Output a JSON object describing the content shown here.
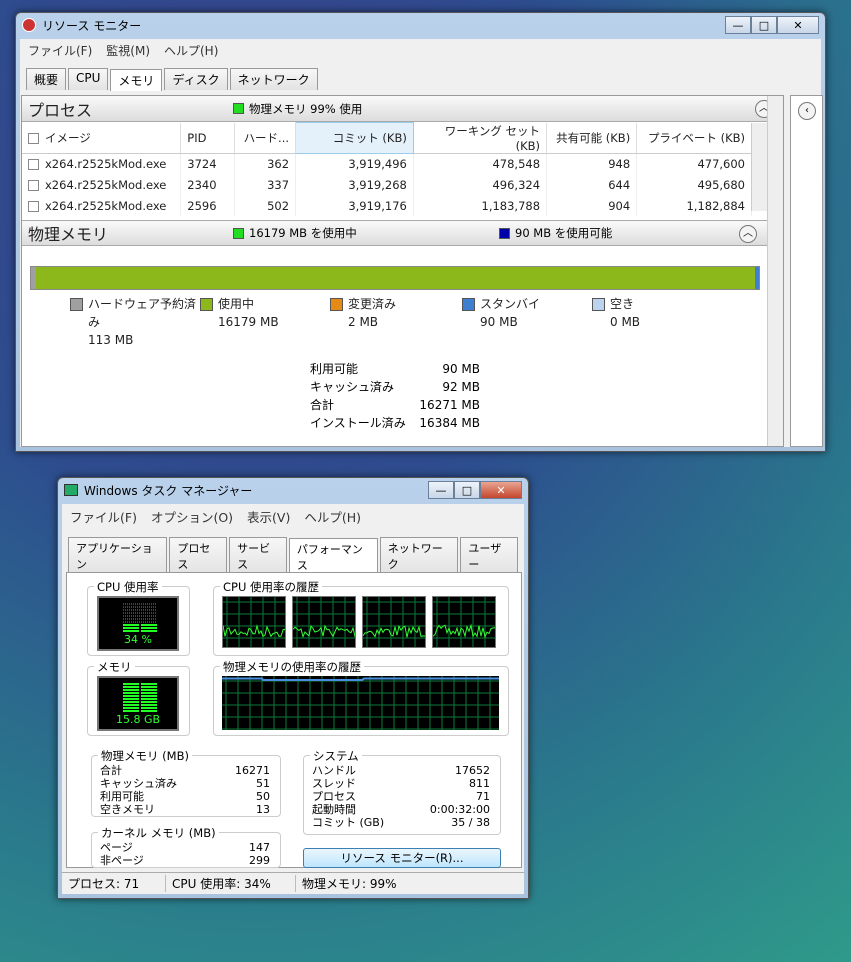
{
  "resmon": {
    "title": "リソース モニター",
    "menu": [
      "ファイル(F)",
      "監視(M)",
      "ヘルプ(H)"
    ],
    "tabs": [
      "概要",
      "CPU",
      "メモリ",
      "ディスク",
      "ネットワーク"
    ],
    "active_tab": "メモリ",
    "process": {
      "title": "プロセス",
      "indicator": "物理メモリ 99% 使用",
      "indicator_color": "#22dd22",
      "columns": [
        "イメージ",
        "PID",
        "ハード...",
        "コミット (KB)",
        "ワーキング セット (KB)",
        "共有可能 (KB)",
        "プライベート (KB)"
      ],
      "rows": [
        [
          "x264.r2525kMod.exe",
          "3724",
          "362",
          "3,919,496",
          "478,548",
          "948",
          "477,600"
        ],
        [
          "x264.r2525kMod.exe",
          "2340",
          "337",
          "3,919,268",
          "496,324",
          "644",
          "495,680"
        ],
        [
          "x264.r2525kMod.exe",
          "2596",
          "502",
          "3,919,176",
          "1,183,788",
          "904",
          "1,182,884"
        ]
      ]
    },
    "physical": {
      "title": "物理メモリ",
      "in_use": "16179 MB を使用中",
      "available": "90 MB を使用可能",
      "legend": [
        {
          "label": "ハードウェア予約済",
          "label2": "み",
          "value": "113 MB",
          "color": "#a0a0a0"
        },
        {
          "label": "使用中",
          "value": "16179 MB",
          "color": "#8db81c"
        },
        {
          "label": "変更済み",
          "value": "2 MB",
          "color": "#e58a14"
        },
        {
          "label": "スタンバイ",
          "value": "90 MB",
          "color": "#3f7fcf"
        },
        {
          "label": "空き",
          "value": "0 MB",
          "color": "#bcd3ef"
        }
      ],
      "stats": [
        [
          "利用可能",
          "90 MB"
        ],
        [
          "キャッシュ済み",
          "92 MB"
        ],
        [
          "合計",
          "16271 MB"
        ],
        [
          "インストール済み",
          "16384 MB"
        ]
      ]
    }
  },
  "taskmgr": {
    "title": "Windows タスク マネージャー",
    "menu": [
      "ファイル(F)",
      "オプション(O)",
      "表示(V)",
      "ヘルプ(H)"
    ],
    "tabs": [
      "アプリケーション",
      "プロセス",
      "サービス",
      "パフォーマンス",
      "ネットワーク",
      "ユーザー"
    ],
    "active_tab": "パフォーマンス",
    "cpu_label": "CPU 使用率",
    "cpu_value": "34 %",
    "cpu_percent": 34,
    "cpu_history_label": "CPU 使用率の履歴",
    "mem_label": "メモリ",
    "mem_value": "15.8 GB",
    "mem_percent": 99,
    "mem_history_label": "物理メモリの使用率の履歴",
    "physical": {
      "label": "物理メモリ (MB)",
      "rows": [
        [
          "合計",
          "16271"
        ],
        [
          "キャッシュ済み",
          "51"
        ],
        [
          "利用可能",
          "50"
        ],
        [
          "空きメモリ",
          "13"
        ]
      ]
    },
    "kernel": {
      "label": "カーネル メモリ (MB)",
      "rows": [
        [
          "ページ",
          "147"
        ],
        [
          "非ページ",
          "299"
        ]
      ]
    },
    "system": {
      "label": "システム",
      "rows": [
        [
          "ハンドル",
          "17652"
        ],
        [
          "スレッド",
          "811"
        ],
        [
          "プロセス",
          "71"
        ],
        [
          "起動時間",
          "0:00:32:00"
        ],
        [
          "コミット (GB)",
          "35 / 38"
        ]
      ]
    },
    "resmon_button": "リソース モニター(R)...",
    "status": [
      "プロセス: 71",
      "CPU 使用率: 34%",
      "物理メモリ: 99%"
    ]
  }
}
